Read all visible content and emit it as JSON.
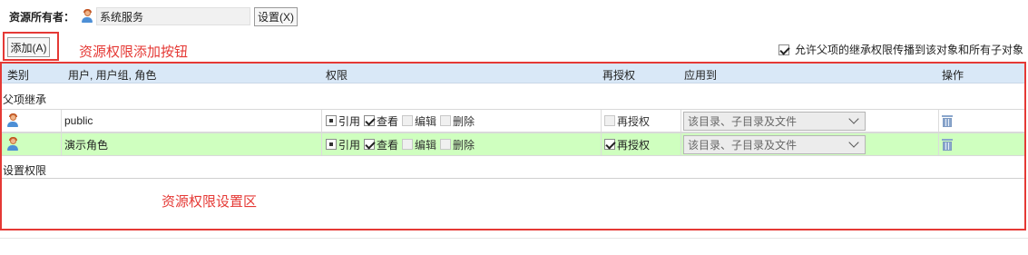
{
  "owner": {
    "label": "资源所有者：",
    "value": "系统服务",
    "set_button": "设置(X)"
  },
  "add_button": "添加(A)",
  "annotations": {
    "add": "资源权限添加按钮",
    "area": "资源权限设置区"
  },
  "inherit_option": {
    "label": "允许父项的继承权限传播到该对象和所有子对象",
    "checked": true
  },
  "table": {
    "headers": [
      "类别",
      "用户, 用户组, 角色",
      "权限",
      "再授权",
      "应用到",
      "操作"
    ],
    "groups": {
      "inherited": "父项继承",
      "set": "设置权限"
    },
    "rows": [
      {
        "name": "public",
        "permissions": [
          {
            "label": "引用",
            "state": "partial"
          },
          {
            "label": "查看",
            "state": "checked"
          },
          {
            "label": "编辑",
            "state": "unchecked"
          },
          {
            "label": "删除",
            "state": "unchecked"
          }
        ],
        "regrant": {
          "label": "再授权",
          "checked": false
        },
        "apply_to": "该目录、子目录及文件",
        "highlight": false
      },
      {
        "name": "演示角色",
        "permissions": [
          {
            "label": "引用",
            "state": "partial"
          },
          {
            "label": "查看",
            "state": "checked"
          },
          {
            "label": "编辑",
            "state": "unchecked"
          },
          {
            "label": "删除",
            "state": "unchecked"
          }
        ],
        "regrant": {
          "label": "再授权",
          "checked": true
        },
        "apply_to": "该目录、子目录及文件",
        "highlight": true
      }
    ]
  },
  "colors": {
    "accent_red": "#e53935",
    "header_bg": "#d9e8f7",
    "highlight_row": "#cfffbf"
  }
}
